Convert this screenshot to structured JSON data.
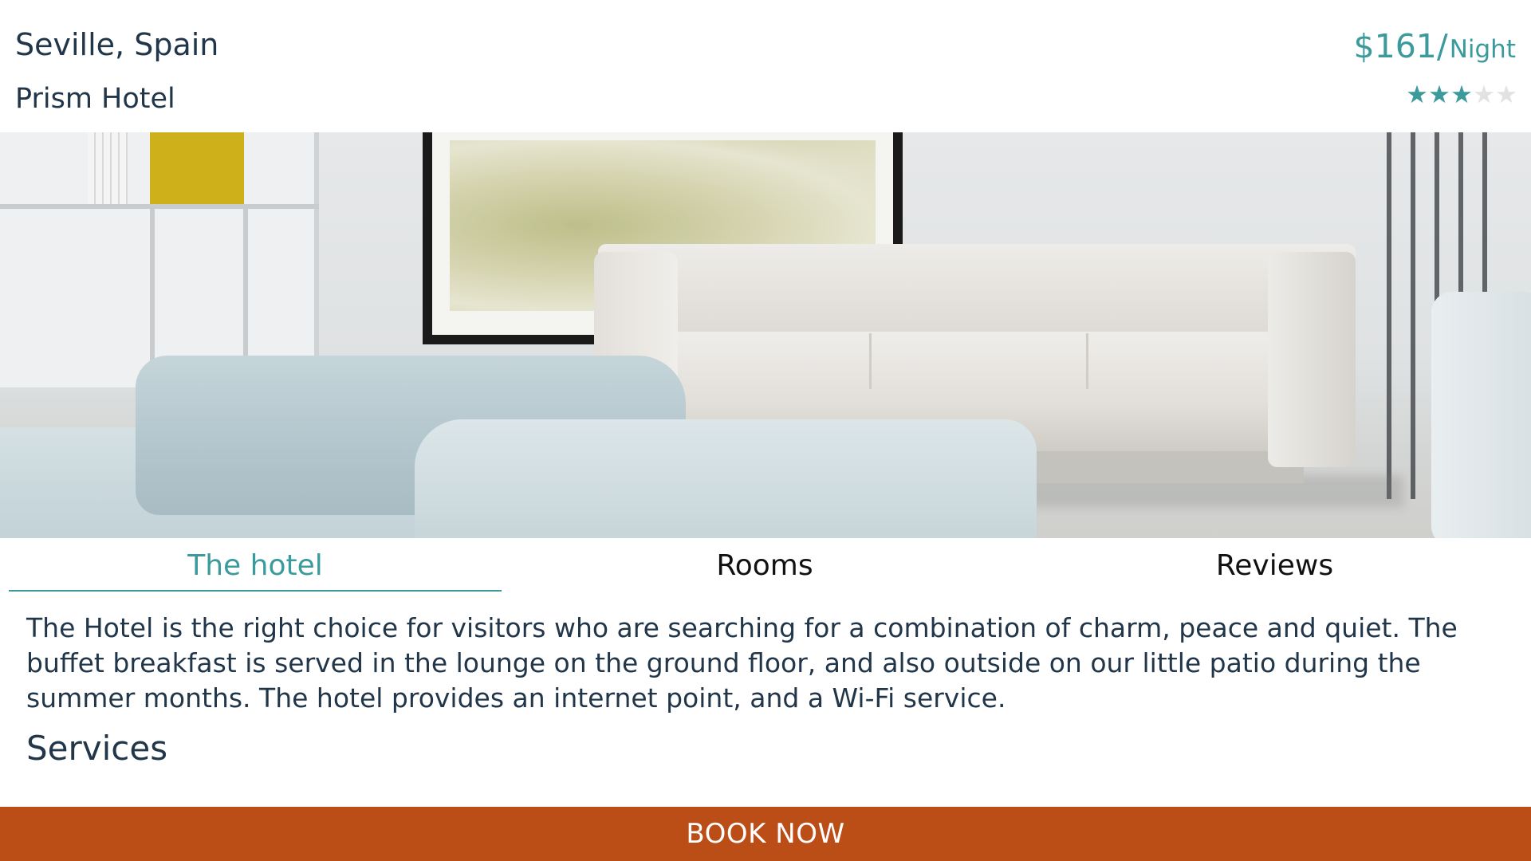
{
  "header": {
    "city": "Seville, Spain",
    "hotel_name": "Prism Hotel",
    "price": "$161/",
    "price_unit": "Night",
    "rating": 3,
    "rating_max": 5,
    "accent_color": "#3a9a9c"
  },
  "hero": {
    "image_subject": "living-room-lounge-photo"
  },
  "tabs": [
    {
      "label": "The hotel",
      "active": true
    },
    {
      "label": "Rooms",
      "active": false
    },
    {
      "label": "Reviews",
      "active": false
    }
  ],
  "content": {
    "description": "The Hotel is the right choice for visitors who are searching for a combination of charm, peace and quiet. The buffet breakfast is served in the lounge on the ground floor, and also outside on our little patio during the summer months. The hotel provides an internet point, and a Wi-Fi service.",
    "services_heading": "Services"
  },
  "book": {
    "label": "BOOK NOW",
    "color": "#bb4d17"
  }
}
